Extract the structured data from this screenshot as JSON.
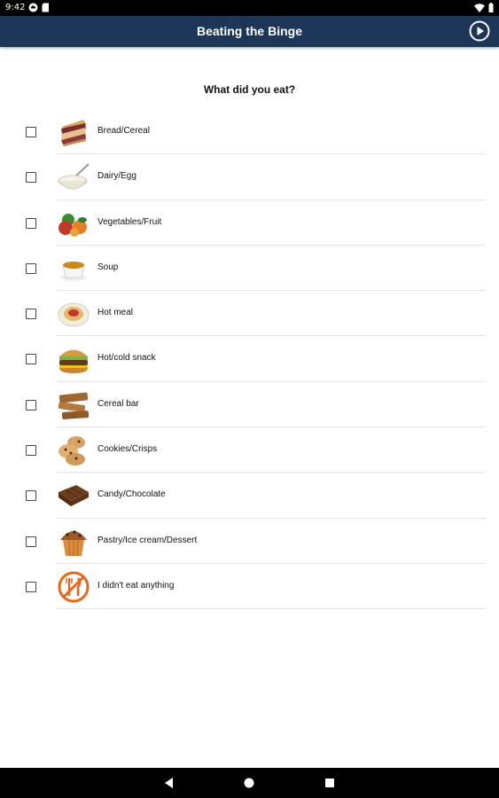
{
  "status_bar": {
    "time": "9:42",
    "icons_left": [
      "cloud-icon",
      "sd-card-icon"
    ],
    "icons_right": [
      "wifi-icon",
      "battery-icon"
    ]
  },
  "app_bar": {
    "title": "Beating the Binge",
    "action_icon": "play-circle-icon",
    "background": "#1d3557"
  },
  "question": "What did you eat?",
  "items": [
    {
      "label": "Bread/Cereal",
      "icon": "sandwich-icon",
      "checked": false
    },
    {
      "label": "Dairy/Egg",
      "icon": "yogurt-bowl-icon",
      "checked": false
    },
    {
      "label": "Vegetables/Fruit",
      "icon": "fruit-vegetables-icon",
      "checked": false
    },
    {
      "label": "Soup",
      "icon": "soup-cup-icon",
      "checked": false
    },
    {
      "label": "Hot meal",
      "icon": "pasta-plate-icon",
      "checked": false
    },
    {
      "label": "Hot/cold snack",
      "icon": "burger-icon",
      "checked": false
    },
    {
      "label": "Cereal bar",
      "icon": "cereal-bar-icon",
      "checked": false
    },
    {
      "label": "Cookies/Crisps",
      "icon": "cookies-icon",
      "checked": false
    },
    {
      "label": "Candy/Chocolate",
      "icon": "chocolate-icon",
      "checked": false
    },
    {
      "label": "Pastry/Ice cream/Dessert",
      "icon": "muffin-icon",
      "checked": false
    },
    {
      "label": "I didn't eat anything",
      "icon": "no-eating-icon",
      "checked": false
    }
  ],
  "nav_bar": {
    "buttons": [
      "back-icon",
      "home-icon",
      "recents-icon"
    ]
  }
}
